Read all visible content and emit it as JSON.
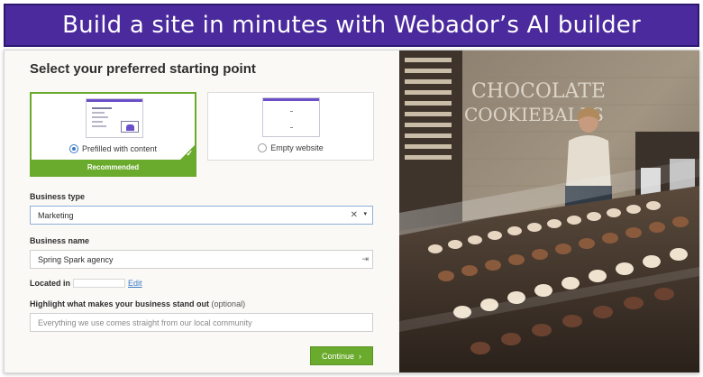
{
  "banner": {
    "title": "Build a site in minutes with Webador’s AI builder"
  },
  "form": {
    "heading": "Select your preferred starting point",
    "options": [
      {
        "label": "Prefilled with content",
        "selected": true,
        "badge": "Recommended"
      },
      {
        "label": "Empty website",
        "selected": false
      }
    ],
    "business_type": {
      "label": "Business type",
      "value": "Marketing"
    },
    "business_name": {
      "label": "Business name",
      "value": "Spring Spark agency"
    },
    "location": {
      "label": "Located in",
      "edit": "Edit"
    },
    "highlight": {
      "label": "Highlight what makes your business stand out",
      "optional": "(optional)",
      "placeholder": "Everything we use comes straight from our local community"
    },
    "continue_label": "Continue",
    "continue_icon": "›"
  },
  "photo": {
    "sign_line1": "CHOCOLATE",
    "sign_line2": "COOKIEBALLS"
  },
  "icons": {
    "clear": "✕",
    "caret": "▾",
    "check": "✓",
    "field_action": "⇥"
  },
  "colors": {
    "banner": "#4a2a9c",
    "accent_green": "#6aaa2c",
    "link_blue": "#3d7ac6"
  }
}
